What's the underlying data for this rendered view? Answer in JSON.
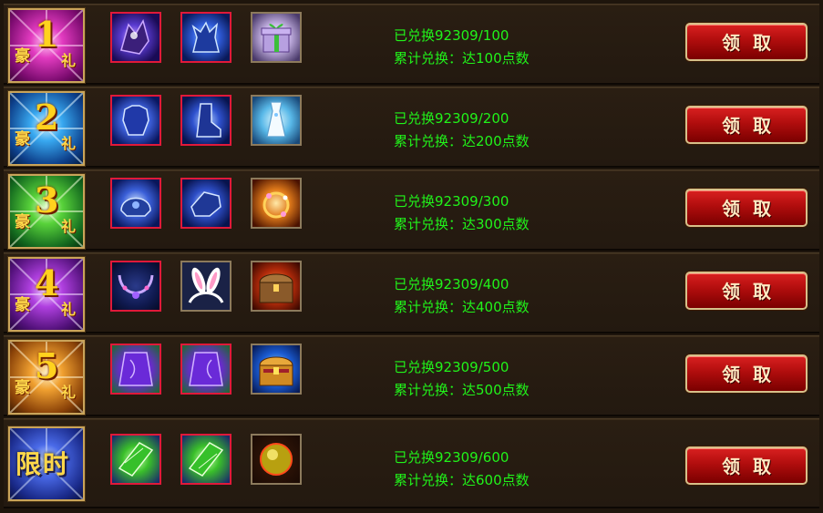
{
  "colors": {
    "progress_text": "#21f31a",
    "button_red": "#c41414",
    "item_border_red": "#e0193a",
    "badge_gold": "#ffd21e"
  },
  "rows": [
    {
      "badge_top": "豪",
      "badge_num": "1",
      "badge_bottom": "礼",
      "badge_theme": "magenta",
      "items": [
        {
          "icon": "dark-dragon-wing-icon",
          "frame": "red"
        },
        {
          "icon": "blue-stag-mount-icon",
          "frame": "red"
        },
        {
          "icon": "gift-box-icon",
          "frame": "gold"
        }
      ],
      "progress": "已兑换92309/100",
      "requirement": "累计兑换：达100点数",
      "claim": "领取"
    },
    {
      "badge_top": "豪",
      "badge_num": "2",
      "badge_bottom": "礼",
      "badge_theme": "blue",
      "items": [
        {
          "icon": "blue-armor-icon",
          "frame": "red"
        },
        {
          "icon": "blue-boots-icon",
          "frame": "red"
        },
        {
          "icon": "white-dress-icon",
          "frame": "gold"
        }
      ],
      "progress": "已兑换92309/200",
      "requirement": "累计兑换：达200点数",
      "claim": "领取"
    },
    {
      "badge_top": "豪",
      "badge_num": "3",
      "badge_bottom": "礼",
      "badge_theme": "green",
      "items": [
        {
          "icon": "blue-helmet-icon",
          "frame": "red"
        },
        {
          "icon": "blue-gauntlet-icon",
          "frame": "red"
        },
        {
          "icon": "flower-ring-icon",
          "frame": "gold"
        }
      ],
      "progress": "已兑换92309/300",
      "requirement": "累计兑换：达300点数",
      "claim": "领取"
    },
    {
      "badge_top": "豪",
      "badge_num": "4",
      "badge_bottom": "礼",
      "badge_theme": "purple",
      "items": [
        {
          "icon": "jewel-necklace-icon",
          "frame": "red"
        },
        {
          "icon": "bunny-ears-icon",
          "frame": "gold"
        },
        {
          "icon": "treasure-chest-icon",
          "frame": "gold"
        }
      ],
      "progress": "已兑换92309/400",
      "requirement": "累计兑换：达400点数",
      "claim": "领取"
    },
    {
      "badge_top": "豪",
      "badge_num": "5",
      "badge_bottom": "礼",
      "badge_theme": "orange",
      "items": [
        {
          "icon": "purple-cape-icon",
          "frame": "red"
        },
        {
          "icon": "purple-cape-icon",
          "frame": "red"
        },
        {
          "icon": "blue-treasure-chest-icon",
          "frame": "gold"
        }
      ],
      "progress": "已兑换92309/500",
      "requirement": "累计兑换：达500点数",
      "claim": "领取"
    },
    {
      "badge_text": "限时",
      "badge_theme": "indigo",
      "items": [
        {
          "icon": "green-crystal-scroll-icon",
          "frame": "red"
        },
        {
          "icon": "green-crystal-scroll-icon",
          "frame": "red"
        },
        {
          "icon": "golden-orb-icon",
          "frame": "gold"
        }
      ],
      "progress": "已兑换92309/600",
      "requirement": "累计兑换：达600点数",
      "claim": "领取"
    }
  ]
}
